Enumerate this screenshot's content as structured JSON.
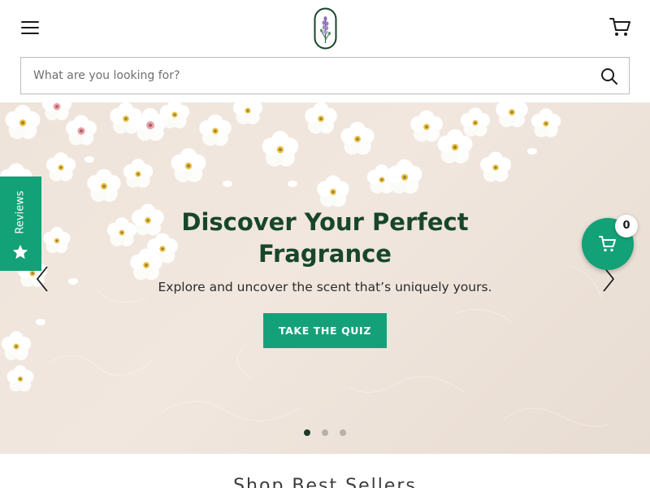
{
  "header": {
    "menu_icon": "hamburger-icon",
    "logo_icon": "lavender-logo-icon",
    "cart_icon": "shopping-cart-icon"
  },
  "search": {
    "placeholder": "What are you looking for?",
    "value": "",
    "icon": "search-icon"
  },
  "hero": {
    "title": "Discover Your Perfect Fragrance",
    "subtitle": "Explore and uncover the scent that’s uniquely yours.",
    "cta_label": "TAKE THE QUIZ",
    "slides_total": 3,
    "active_slide": 1
  },
  "reviews_tab": {
    "label": "Reviews",
    "icon": "star-icon"
  },
  "floating_cart": {
    "icon": "cart-icon",
    "count": "0"
  },
  "section": {
    "title": "Shop Best Sellers"
  },
  "colors": {
    "accent": "#14a17a",
    "title_green": "#17462b",
    "hero_bg": "#efe4da"
  }
}
